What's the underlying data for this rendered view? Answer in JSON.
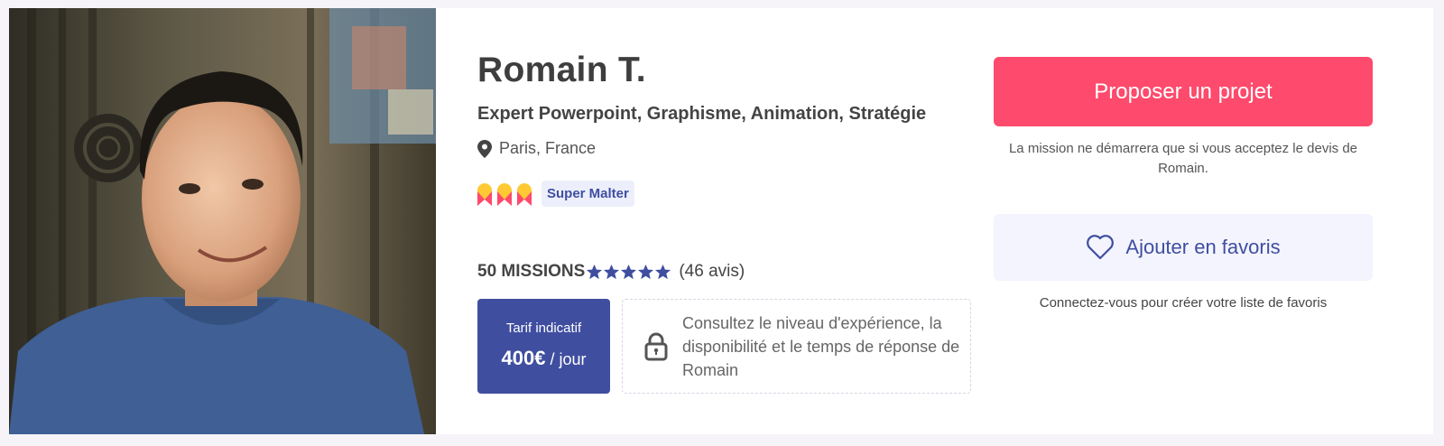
{
  "profile": {
    "name": "Romain T.",
    "headline": "Expert Powerpoint, Graphisme, Animation, Stratégie",
    "location": "Paris, France",
    "super_tag": "Super Malter",
    "missions": "50 MISSIONS",
    "rating_stars": 5,
    "reviews": "(46 avis)"
  },
  "rate": {
    "label": "Tarif indicatif",
    "amount": "400€",
    "unit": " / jour"
  },
  "locked": {
    "text": "Consultez le niveau d'expérience, la disponibilité et le temps de réponse de Romain"
  },
  "actions": {
    "propose_label": "Proposer un projet",
    "propose_note": "La mission ne démarrera que si vous acceptez le devis de Romain.",
    "favorite_label": "Ajouter en favoris",
    "favorite_note": "Connectez-vous pour créer votre liste de favoris"
  },
  "colors": {
    "primary": "#fe4a6c",
    "brand_blue": "#3f4e9f",
    "badge_yellow": "#ffc933",
    "badge_pink": "#fe4a6c"
  },
  "icons": {
    "location": "map-pin-icon",
    "lock": "lock-icon",
    "heart": "heart-icon",
    "star": "star-icon",
    "badge": "super-malter-badge-icon"
  }
}
